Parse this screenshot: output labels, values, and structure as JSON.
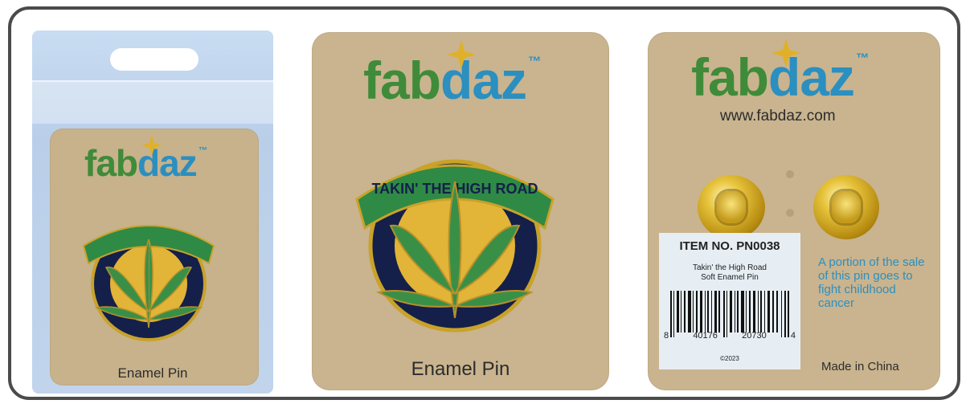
{
  "brand": {
    "part1": "fab",
    "part2": "daz",
    "tm": "™"
  },
  "panel_left": {
    "caption": "Enamel Pin"
  },
  "panel_middle": {
    "caption": "Enamel Pin"
  },
  "panel_right": {
    "url": "www.fabdaz.com",
    "label": {
      "item_no": "ITEM NO. PN0038",
      "line1": "Takin' the High Road",
      "line2": "Soft Enamel Pin",
      "barcode_digits": [
        "8",
        "40176",
        "20730",
        "4"
      ],
      "copyright": "©2023"
    },
    "charity_text": "A portion of the sale of this pin goes to fight childhood cancer",
    "made_in": "Made in China"
  },
  "pin": {
    "ring_text": "TAKIN' THE HIGH ROAD"
  },
  "colors": {
    "frame": "#4b4b4b",
    "card": "#c9b48f",
    "brand_green": "#3f8b3a",
    "brand_blue": "#2b8fc0",
    "pin_green": "#2f8a45",
    "pin_navy": "#14204a",
    "gold": "#d9b22a"
  }
}
